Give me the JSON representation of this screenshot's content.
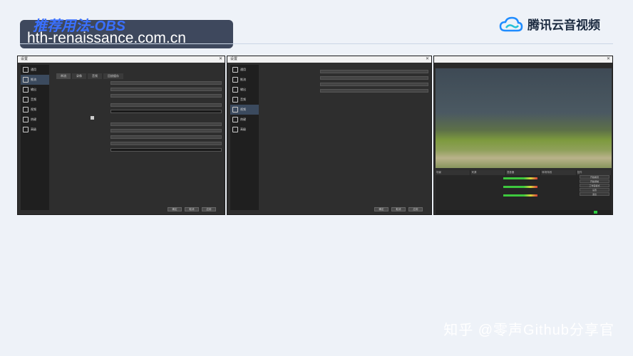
{
  "header": {
    "title": "推荐用法-OBS",
    "url": "hth-renaissance.com.cn"
  },
  "brand": {
    "name": "腾讯云音视频",
    "logo_icon": "cloud-logo-icon",
    "accent_color": "#1f8cff"
  },
  "watermark": "知乎 @零声Github分享官",
  "screenshots": {
    "settings_general": {
      "window_title": "设置",
      "sidebar": [
        "通用",
        "推流",
        "输出",
        "音频",
        "视频",
        "热键",
        "高级"
      ],
      "active_index": 1,
      "tabs": [
        "串流",
        "录像",
        "音频",
        "回放缓存"
      ],
      "buttons": [
        "确定",
        "取消",
        "应用"
      ]
    },
    "settings_video": {
      "window_title": "设置",
      "sidebar": [
        "通用",
        "推流",
        "输出",
        "音频",
        "视频",
        "热键",
        "高级"
      ],
      "active_index": 4,
      "buttons": [
        "确定",
        "取消",
        "应用"
      ]
    },
    "obs_main": {
      "docks": [
        "场景",
        "来源",
        "混音器",
        "转场特效",
        "控件"
      ],
      "controls": [
        "开始推流",
        "开始录制",
        "工作室模式",
        "设置",
        "退出"
      ]
    }
  }
}
